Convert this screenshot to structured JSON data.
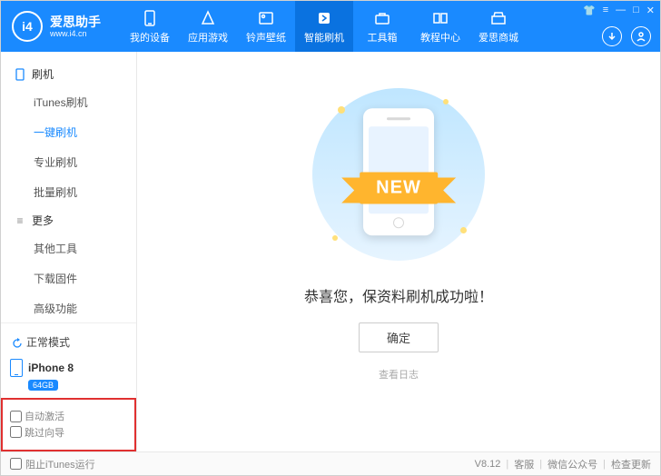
{
  "app": {
    "title": "爱思助手",
    "subtitle": "www.i4.cn",
    "logo_text": "i4"
  },
  "nav": {
    "tabs": [
      {
        "label": "我的设备"
      },
      {
        "label": "应用游戏"
      },
      {
        "label": "铃声壁纸"
      },
      {
        "label": "智能刷机"
      },
      {
        "label": "工具箱"
      },
      {
        "label": "教程中心"
      },
      {
        "label": "爱思商城"
      }
    ],
    "active_index": 3
  },
  "sidebar": {
    "groups": [
      {
        "title": "刷机",
        "items": [
          {
            "label": "iTunes刷机"
          },
          {
            "label": "一键刷机"
          },
          {
            "label": "专业刷机"
          },
          {
            "label": "批量刷机"
          }
        ],
        "active_index": 1
      },
      {
        "title": "更多",
        "items": [
          {
            "label": "其他工具"
          },
          {
            "label": "下载固件"
          },
          {
            "label": "高级功能"
          }
        ]
      }
    ],
    "mode_label": "正常模式",
    "device_name": "iPhone 8",
    "storage_badge": "64GB",
    "checkboxes": [
      {
        "label": "自动激活"
      },
      {
        "label": "跳过向导"
      }
    ]
  },
  "main": {
    "ribbon_text": "NEW",
    "success_message": "恭喜您，保资料刷机成功啦！",
    "ok_button": "确定",
    "log_link": "查看日志"
  },
  "footer": {
    "block_itunes": "阻止iTunes运行",
    "version": "V8.12",
    "links": [
      {
        "label": "客服"
      },
      {
        "label": "微信公众号"
      },
      {
        "label": "检查更新"
      }
    ]
  }
}
